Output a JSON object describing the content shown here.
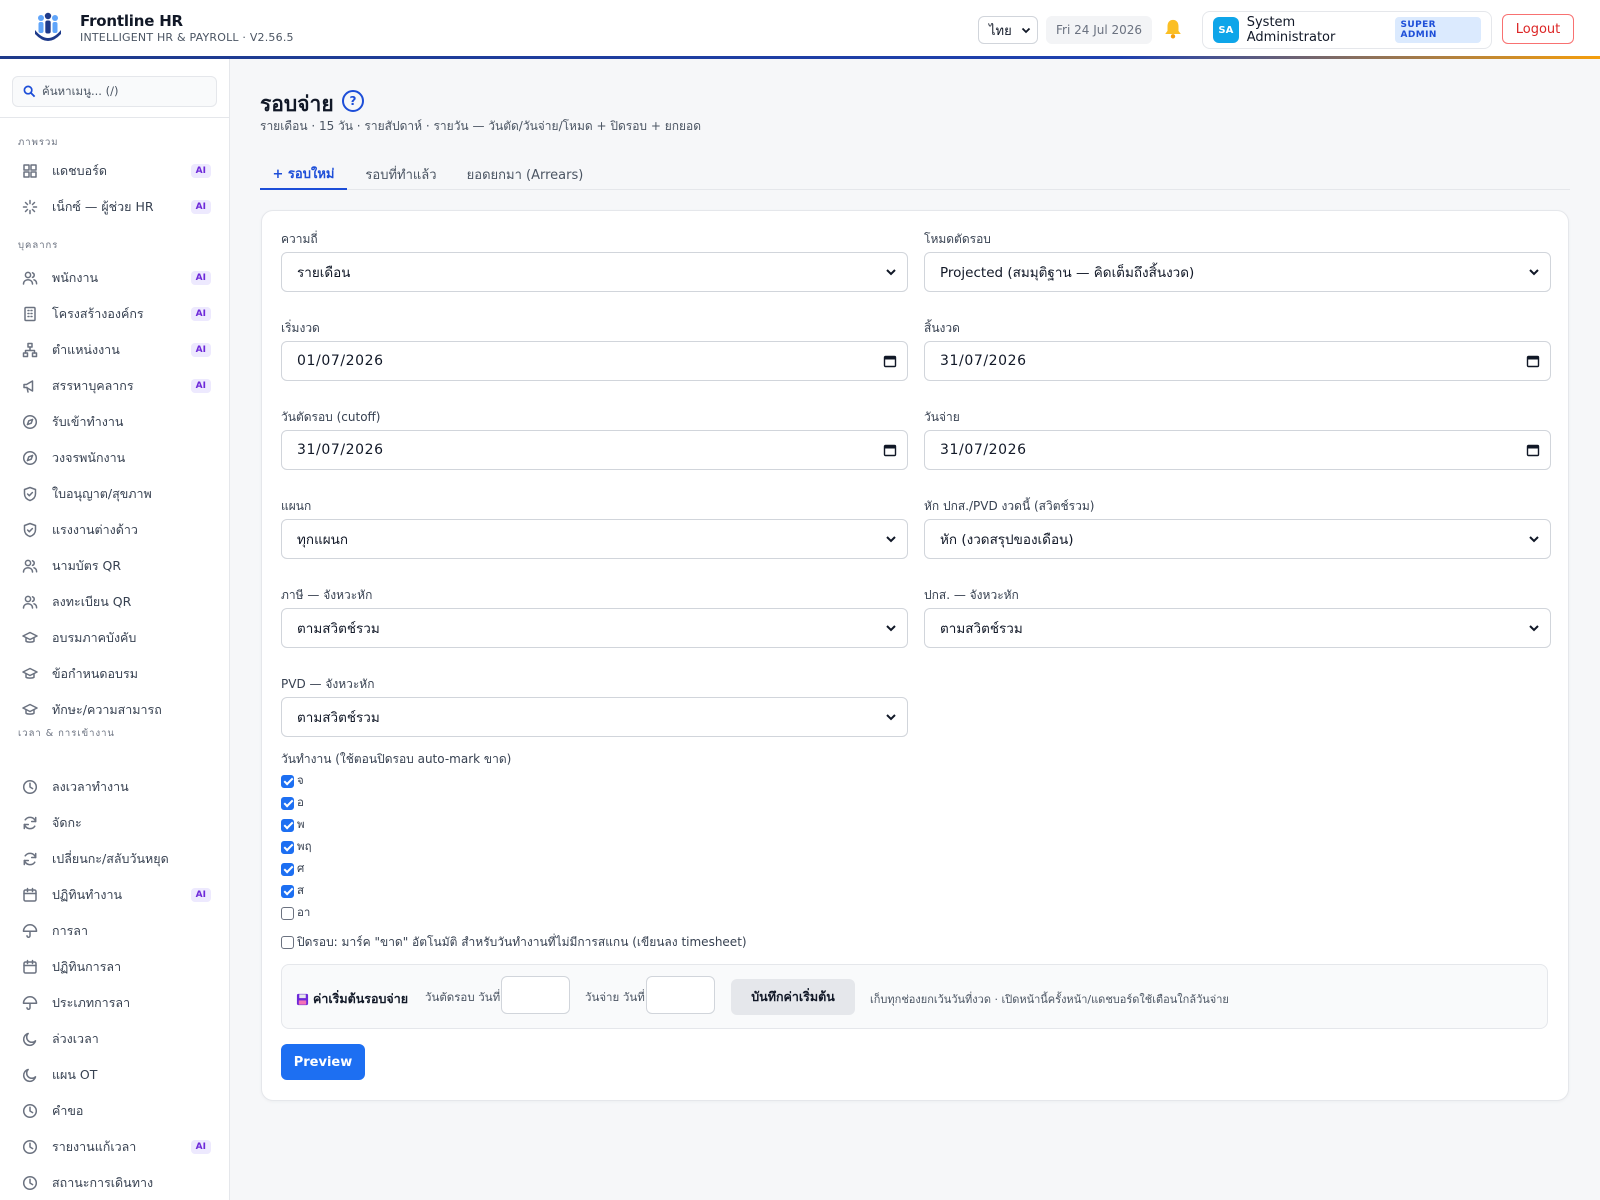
{
  "header": {
    "brand_name": "Frontline HR",
    "brand_sub": "INTELLIGENT HR & PAYROLL · V2.56.5",
    "language": "ไทย",
    "date": "Fri 24 Jul 2026",
    "user_initials": "SA",
    "user_name": "System Administrator",
    "user_role": "SUPER ADMIN",
    "logout_label": "Logout",
    "accent_color": "#1e40af"
  },
  "sidebar": {
    "search_placeholder": "ค้นหาเมนู... (/)",
    "sections": [
      {
        "title": "ภาพรวม"
      },
      {
        "title": "บุคลากร"
      },
      {
        "title": "เวลา & การเข้างาน"
      }
    ],
    "items": [
      {
        "label": "แดชบอร์ด",
        "icon": "grid-icon",
        "ai": "AI"
      },
      {
        "label": "เน็กซ์ — ผู้ช่วย HR",
        "icon": "sparkle-icon",
        "ai": "AI"
      },
      {
        "label": "พนักงาน",
        "icon": "users-icon",
        "ai": "AI"
      },
      {
        "label": "โครงสร้างองค์กร",
        "icon": "building-icon",
        "ai": "AI"
      },
      {
        "label": "ตำแหน่งงาน",
        "icon": "org-chart-icon",
        "ai": "AI"
      },
      {
        "label": "สรรหาบุคลากร",
        "icon": "megaphone-icon",
        "ai": "AI"
      },
      {
        "label": "รับเข้าทำงาน",
        "icon": "compass-icon",
        "ai": ""
      },
      {
        "label": "วงจรพนักงาน",
        "icon": "compass-icon",
        "ai": ""
      },
      {
        "label": "ใบอนุญาต/สุขภาพ",
        "icon": "shield-icon",
        "ai": ""
      },
      {
        "label": "แรงงานต่างด้าว",
        "icon": "shield-icon",
        "ai": ""
      },
      {
        "label": "นามบัตร QR",
        "icon": "users-icon",
        "ai": ""
      },
      {
        "label": "ลงทะเบียน QR",
        "icon": "users-icon",
        "ai": ""
      },
      {
        "label": "อบรมภาคบังคับ",
        "icon": "graduation-cap-icon",
        "ai": ""
      },
      {
        "label": "ข้อกำหนดอบรม",
        "icon": "graduation-cap-icon",
        "ai": ""
      },
      {
        "label": "ทักษะ/ความสามารถ",
        "icon": "graduation-cap-icon",
        "ai": ""
      },
      {
        "label": "ลงเวลาทำงาน",
        "icon": "clock-icon",
        "ai": ""
      },
      {
        "label": "จัดกะ",
        "icon": "refresh-icon",
        "ai": ""
      },
      {
        "label": "เปลี่ยนกะ/สลับวันหยุด",
        "icon": "refresh-icon",
        "ai": ""
      },
      {
        "label": "ปฏิทินทำงาน",
        "icon": "calendar-icon",
        "ai": "AI"
      },
      {
        "label": "การลา",
        "icon": "umbrella-icon",
        "ai": ""
      },
      {
        "label": "ปฏิทินการลา",
        "icon": "calendar-icon",
        "ai": ""
      },
      {
        "label": "ประเภทการลา",
        "icon": "umbrella-icon",
        "ai": ""
      },
      {
        "label": "ล่วงเวลา",
        "icon": "moon-icon",
        "ai": ""
      },
      {
        "label": "แผน OT",
        "icon": "moon-icon",
        "ai": ""
      },
      {
        "label": "คำขอ",
        "icon": "clock-icon",
        "ai": ""
      },
      {
        "label": "รายงานแก้เวลา",
        "icon": "clock-icon",
        "ai": "AI"
      },
      {
        "label": "สถานะการเดินทาง",
        "icon": "clock-icon",
        "ai": ""
      }
    ]
  },
  "main": {
    "title": "รอบจ่าย",
    "help": "?",
    "subtitle": "รายเดือน · 15 วัน · รายสัปดาห์ · รายวัน — วันตัด/วันจ่าย/โหมด + ปิดรอบ + ยกยอด",
    "tabs": [
      "+ รอบใหม่",
      "รอบที่ทำแล้ว",
      "ยอดยกมา (Arrears)"
    ],
    "form": {
      "frequency_label": "ความถี่",
      "frequency_value": "รายเดือน",
      "cut_mode_label": "โหมดตัดรอบ",
      "cut_mode_value": "Projected (สมมุติฐาน — คิดเต็มถึงสิ้นงวด)",
      "period_start_label": "เริ่มงวด",
      "period_start_value": "01/07/2026",
      "period_end_label": "สิ้นงวด",
      "period_end_value": "31/07/2026",
      "cutoff_label": "วันตัดรอบ (cutoff)",
      "cutoff_value": "31/07/2026",
      "pay_date_label": "วันจ่าย",
      "pay_date_value": "31/07/2026",
      "department_label": "แผนก",
      "department_value": "ทุกแผนก",
      "sso_pvd_label": "หัก ปกส./PVD งวดนี้ (สวิตช์รวม)",
      "sso_pvd_value": "หัก (งวดสรุปของเดือน)",
      "tax_label": "ภาษี — จังหวะหัก",
      "tax_value": "ตามสวิตช์รวม",
      "sso_label": "ปกส. — จังหวะหัก",
      "sso_value": "ตามสวิตช์รวม",
      "pvd_label": "PVD — จังหวะหัก",
      "pvd_value": "ตามสวิตช์รวม",
      "workdays_label": "วันทำงาน (ใช้ตอนปิดรอบ auto-mark ขาด)",
      "workdays": [
        {
          "label": "จ",
          "checked": true
        },
        {
          "label": "อ",
          "checked": true
        },
        {
          "label": "พ",
          "checked": true
        },
        {
          "label": "พฤ",
          "checked": true
        },
        {
          "label": "ศ",
          "checked": true
        },
        {
          "label": "ส",
          "checked": true
        },
        {
          "label": "อา",
          "checked": false
        }
      ],
      "automark_label": "ปิดรอบ: มาร์ค \"ขาด\" อัตโนมัติ สำหรับวันทำงานที่ไม่มีการสแกน (เขียนลง timesheet)",
      "automark_checked": false
    },
    "defaults": {
      "title": "ค่าเริ่มต้นรอบจ่าย",
      "cutoff_day_label": "วันตัดรอบ วันที่",
      "cutoff_day_value": "",
      "pay_day_label": "วันจ่าย วันที่",
      "pay_day_value": "",
      "save_label": "บันทึกค่าเริ่มต้น",
      "note": "เก็บทุกช่องยกเว้นวันที่งวด · เปิดหน้านี้ครั้งหน้า/แดชบอร์ดใช้เตือนใกล้วันจ่าย"
    },
    "preview_label": "Preview",
    "primary_color": "#1d6ff2"
  }
}
